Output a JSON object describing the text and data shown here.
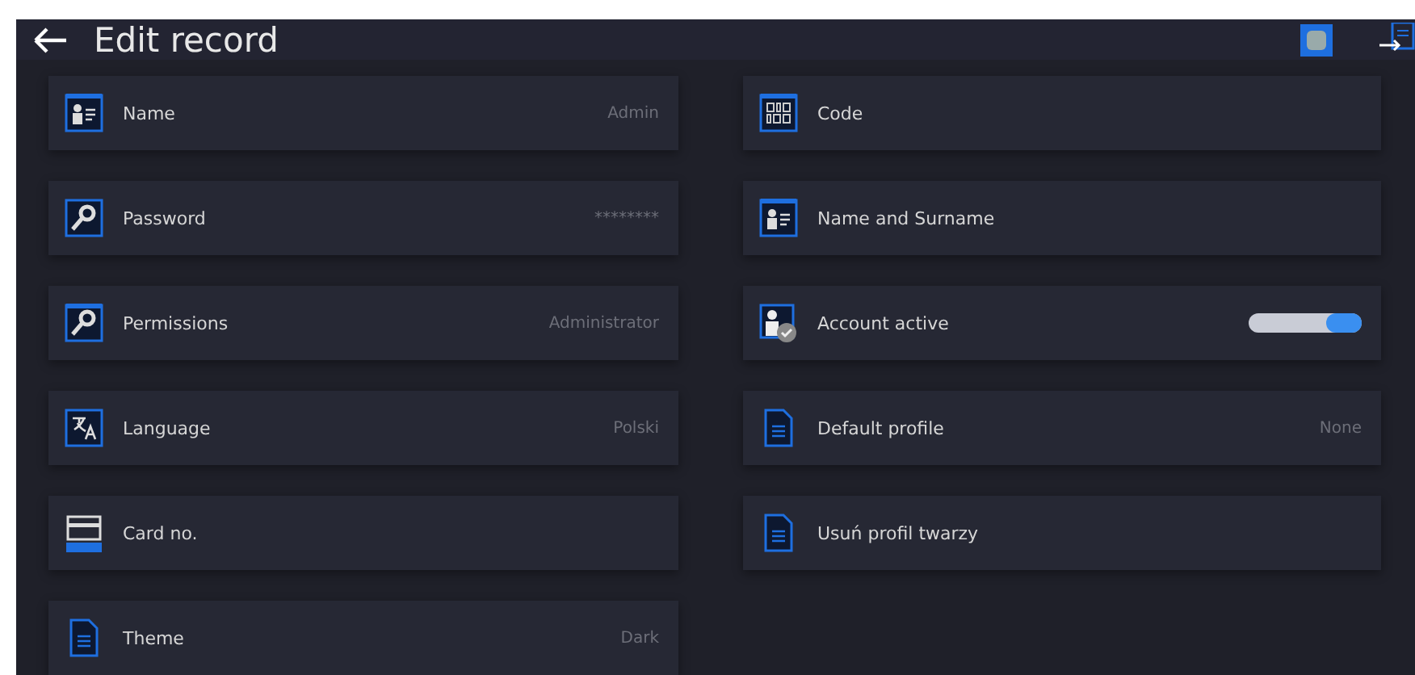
{
  "header": {
    "title": "Edit record"
  },
  "left_rows": [
    {
      "kind": "value",
      "label": "Name",
      "value": "Admin"
    },
    {
      "kind": "value",
      "label": "Password",
      "value": "********"
    },
    {
      "kind": "value",
      "label": "Permissions",
      "value": "Administrator"
    },
    {
      "kind": "value",
      "label": "Language",
      "value": "Polski"
    },
    {
      "kind": "value",
      "label": "Card no."
    },
    {
      "kind": "value",
      "label": "Theme",
      "value": "Dark"
    }
  ],
  "right_rows": [
    {
      "kind": "value",
      "label": "Code"
    },
    {
      "kind": "value",
      "label": "Name and Surname"
    },
    {
      "kind": "toggle",
      "label": "Account active",
      "on": true
    },
    {
      "kind": "value",
      "label": "Default profile",
      "value": "None"
    },
    {
      "kind": "value",
      "label": "Usuń profil twarzy"
    }
  ]
}
